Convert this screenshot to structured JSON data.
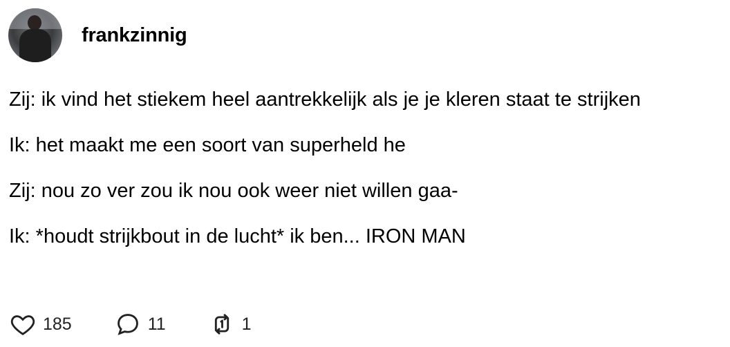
{
  "user": {
    "username": "frankzinnig"
  },
  "post": {
    "lines": [
      "Zij: ik vind het stiekem heel aantrekkelijk als je je kleren staat te strijken",
      "Ik: het maakt me een soort van superheld he",
      "Zij: nou zo ver zou ik nou ook weer niet willen gaa-",
      "Ik: *houdt strijkbout in de lucht* ik ben... IRON MAN"
    ]
  },
  "actions": {
    "likes": "185",
    "comments": "11",
    "reposts": "1",
    "icons": [
      "heart-icon",
      "comment-icon",
      "repost-icon"
    ]
  }
}
